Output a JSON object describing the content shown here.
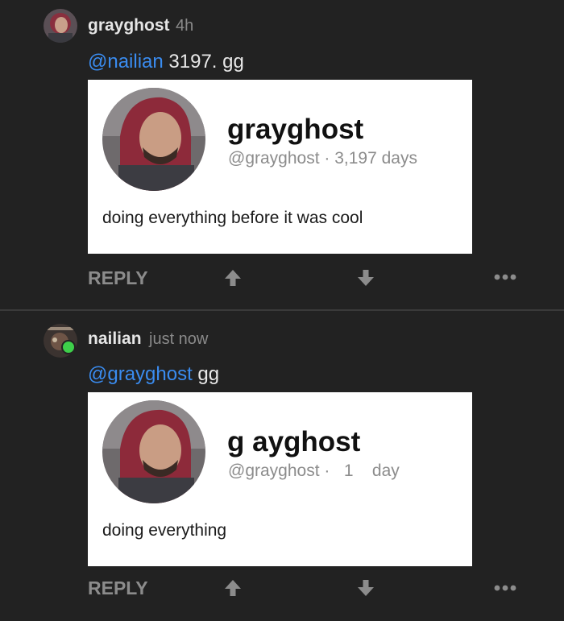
{
  "comments": [
    {
      "username": "grayghost",
      "timestamp": "4h",
      "mention": "@nailian",
      "text": " 3197. gg",
      "card": {
        "name": "grayghost",
        "handle": "@grayghost · 3,197 days",
        "bio": "doing everything before it was cool"
      },
      "reply_label": "REPLY",
      "online": false
    },
    {
      "username": "nailian",
      "timestamp": "just now",
      "mention": "@grayghost",
      "text": " gg",
      "card": {
        "name": "g ayghost",
        "handle": "@grayghost ·   1    day",
        "bio": "doing everything"
      },
      "reply_label": "REPLY",
      "online": true
    }
  ],
  "icons": {
    "upvote": "arrow-up-icon",
    "downvote": "arrow-down-icon",
    "more": "more-dots-icon"
  },
  "colors": {
    "background": "#222222",
    "mention": "#3a8cf0",
    "online": "#3ecf4a"
  }
}
